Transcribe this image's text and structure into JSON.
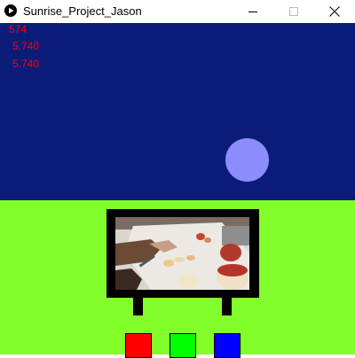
{
  "window": {
    "title": "Sunrise_Project_Jason",
    "icons": {
      "app": "play-circle-icon",
      "minimize": "minimize-icon",
      "maximize": "maximize-icon",
      "close": "close-icon"
    }
  },
  "sketch": {
    "readouts": [
      "574",
      "5.740",
      "5.740"
    ],
    "colors": {
      "sky": "#0B1C78",
      "ground": "#82FF2A",
      "sun": "#8C8CFF",
      "readout_text": "#FF0000",
      "tv_frame": "#000000"
    },
    "color_buttons": [
      {
        "name": "red",
        "color": "#FF0000"
      },
      {
        "name": "green",
        "color": "#00FF00"
      },
      {
        "name": "blue",
        "color": "#0000FF"
      }
    ]
  }
}
